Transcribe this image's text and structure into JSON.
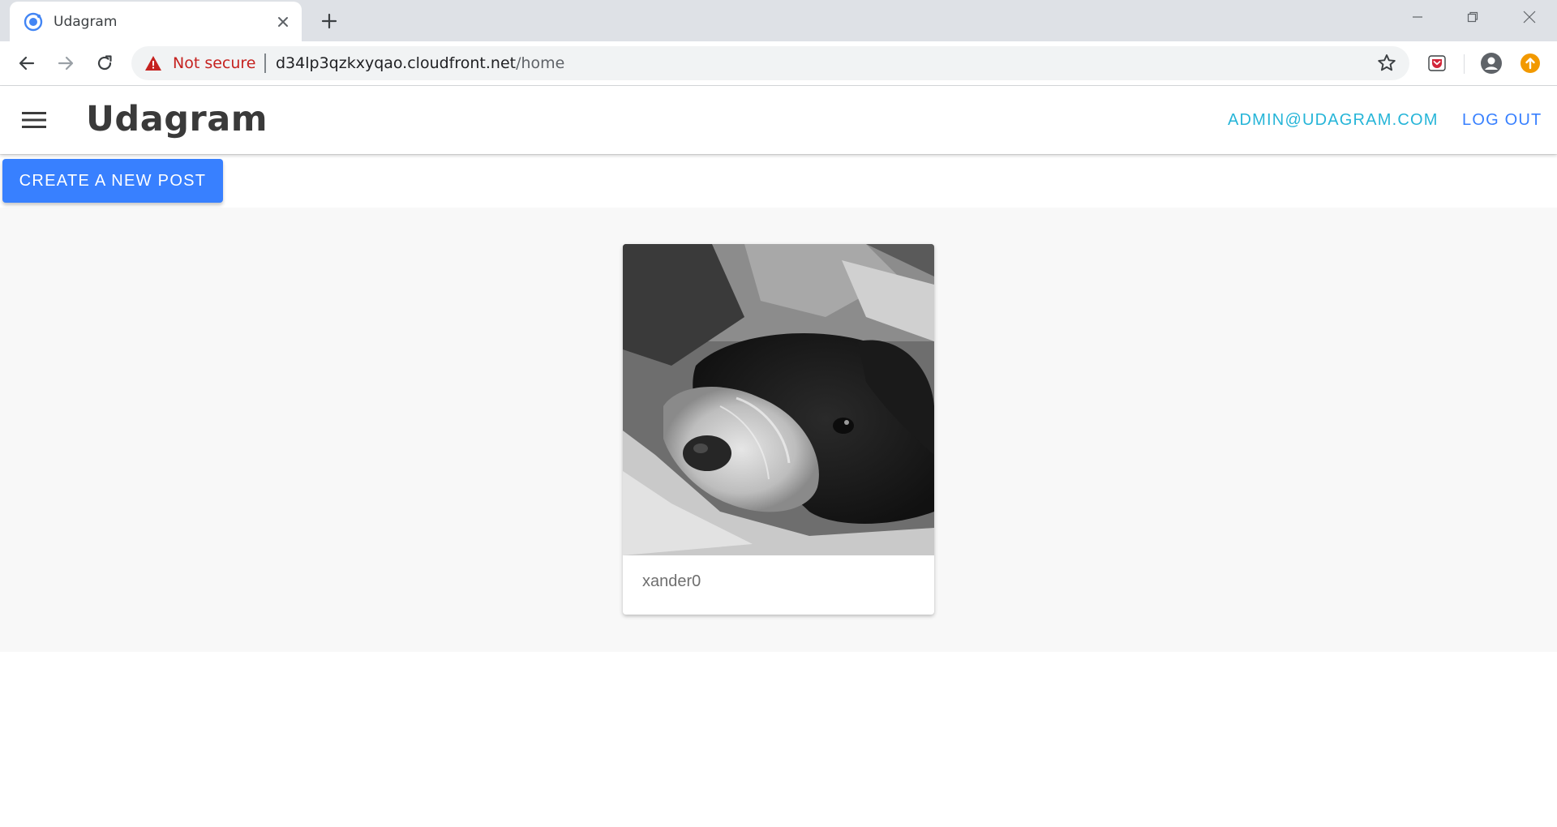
{
  "browser": {
    "tab": {
      "title": "Udagram",
      "close_icon": "close-icon",
      "favicon": "ionic-logo-icon"
    },
    "new_tab_icon": "plus-icon",
    "window_controls": [
      "minimize-icon",
      "restore-icon",
      "close-icon"
    ],
    "address_bar": {
      "security_label": "Not secure",
      "url_host": "d34lp3qzkxyqao.cloudfront.net",
      "url_path": "/home"
    },
    "colors": {
      "tab_strip": "#dee1e6",
      "warning": "#c5221f",
      "extension_update": "#f29900"
    }
  },
  "header": {
    "title": "Udagram",
    "user_email": "admin@udagram.com",
    "logout_label": "Log out",
    "menu_icon": "hamburger-menu-icon",
    "colors": {
      "email": "#26b5d8",
      "logout": "#3880ff"
    }
  },
  "actions": {
    "create_post_label": "Create a new post",
    "color": "#3880ff"
  },
  "feed": {
    "posts": [
      {
        "caption": "xander0",
        "image": "black-and-white photo of a shaggy dog resting its head"
      }
    ],
    "background": "#f8f8f8"
  }
}
